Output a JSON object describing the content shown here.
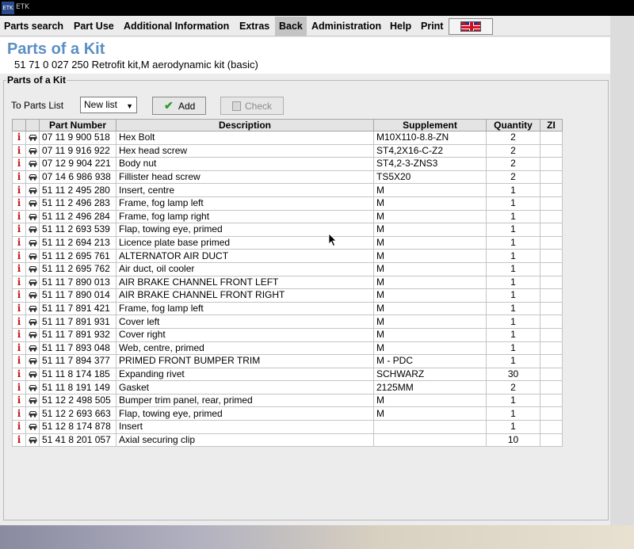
{
  "app": {
    "title": "ETK"
  },
  "menu": {
    "items": [
      {
        "label": "Parts search"
      },
      {
        "label": "Part Use"
      },
      {
        "label": "Additional Information"
      },
      {
        "label": "Extras"
      },
      {
        "label": "Back"
      },
      {
        "label": "Administration"
      },
      {
        "label": "Help"
      },
      {
        "label": "Print"
      }
    ],
    "active": "Back"
  },
  "header": {
    "title": "Parts of a Kit",
    "subtitle": "51 71 0 027 250 Retrofit kit,M aerodynamic kit (basic)"
  },
  "group": {
    "label": "Parts of a Kit",
    "to_parts_list_label": "To Parts List",
    "list_select_value": "New list",
    "add_label": "Add",
    "check_label": "Check"
  },
  "table": {
    "columns": [
      "Part Number",
      "Description",
      "Supplement",
      "Quantity",
      "ZI"
    ],
    "rows": [
      {
        "part": "07 11 9 900 518",
        "desc": "Hex Bolt",
        "supp": "M10X110-8.8-ZN",
        "qty": "2",
        "zi": ""
      },
      {
        "part": "07 11 9 916 922",
        "desc": "Hex head screw",
        "supp": "ST4,2X16-C-Z2",
        "qty": "2",
        "zi": ""
      },
      {
        "part": "07 12 9 904 221",
        "desc": "Body nut",
        "supp": "ST4,2-3-ZNS3",
        "qty": "2",
        "zi": ""
      },
      {
        "part": "07 14 6 986 938",
        "desc": "Fillister head screw",
        "supp": "TS5X20",
        "qty": "2",
        "zi": ""
      },
      {
        "part": "51 11 2 495 280",
        "desc": "Insert, centre",
        "supp": "M",
        "qty": "1",
        "zi": ""
      },
      {
        "part": "51 11 2 496 283",
        "desc": "Frame, fog lamp left",
        "supp": "M",
        "qty": "1",
        "zi": ""
      },
      {
        "part": "51 11 2 496 284",
        "desc": "Frame, fog lamp right",
        "supp": "M",
        "qty": "1",
        "zi": ""
      },
      {
        "part": "51 11 2 693 539",
        "desc": "Flap, towing eye, primed",
        "supp": "M",
        "qty": "1",
        "zi": ""
      },
      {
        "part": "51 11 2 694 213",
        "desc": "Licence plate base primed",
        "supp": "M",
        "qty": "1",
        "zi": ""
      },
      {
        "part": "51 11 2 695 761",
        "desc": "ALTERNATOR AIR DUCT",
        "supp": "M",
        "qty": "1",
        "zi": ""
      },
      {
        "part": "51 11 2 695 762",
        "desc": "Air duct, oil cooler",
        "supp": "M",
        "qty": "1",
        "zi": ""
      },
      {
        "part": "51 11 7 890 013",
        "desc": "AIR BRAKE CHANNEL FRONT LEFT",
        "supp": "M",
        "qty": "1",
        "zi": ""
      },
      {
        "part": "51 11 7 890 014",
        "desc": "AIR BRAKE CHANNEL FRONT RIGHT",
        "supp": "M",
        "qty": "1",
        "zi": ""
      },
      {
        "part": "51 11 7 891 421",
        "desc": "Frame, fog lamp left",
        "supp": "M",
        "qty": "1",
        "zi": ""
      },
      {
        "part": "51 11 7 891 931",
        "desc": "Cover left",
        "supp": "M",
        "qty": "1",
        "zi": ""
      },
      {
        "part": "51 11 7 891 932",
        "desc": "Cover right",
        "supp": "M",
        "qty": "1",
        "zi": ""
      },
      {
        "part": "51 11 7 893 048",
        "desc": "Web, centre, primed",
        "supp": "M",
        "qty": "1",
        "zi": ""
      },
      {
        "part": "51 11 7 894 377",
        "desc": "PRIMED FRONT BUMPER TRIM",
        "supp": "M - PDC",
        "qty": "1",
        "zi": ""
      },
      {
        "part": "51 11 8 174 185",
        "desc": "Expanding rivet",
        "supp": "SCHWARZ",
        "qty": "30",
        "zi": ""
      },
      {
        "part": "51 11 8 191 149",
        "desc": "Gasket",
        "supp": "2125MM",
        "qty": "2",
        "zi": ""
      },
      {
        "part": "51 12 2 498 505",
        "desc": "Bumper trim panel, rear, primed",
        "supp": "M",
        "qty": "1",
        "zi": ""
      },
      {
        "part": "51 12 2 693 663",
        "desc": "Flap, towing eye, primed",
        "supp": "M",
        "qty": "1",
        "zi": ""
      },
      {
        "part": "51 12 8 174 878",
        "desc": "Insert",
        "supp": "",
        "qty": "1",
        "zi": ""
      },
      {
        "part": "51 41 8 201 057",
        "desc": "Axial securing clip",
        "supp": "",
        "qty": "10",
        "zi": ""
      }
    ]
  },
  "colors": {
    "title_blue": "#5b8fc3",
    "info_red": "#c41818",
    "check_green": "#2d9a2d"
  },
  "icons": {
    "info": "i",
    "add": "✔",
    "list_select_arrow": "▼"
  }
}
